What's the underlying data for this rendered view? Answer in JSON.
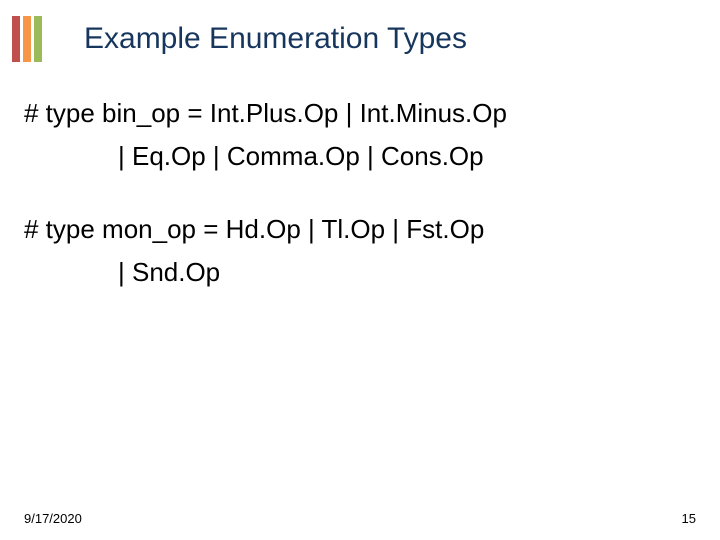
{
  "header": {
    "title": "Example Enumeration Types"
  },
  "body": {
    "p1a": "# type bin_op = Int.Plus.Op |  Int.Minus.Op",
    "p1b": "|  Eq.Op | Comma.Op | Cons.Op",
    "p2a": "# type mon_op = Hd.Op | Tl.Op | Fst.Op",
    "p2b": "| Snd.Op"
  },
  "footer": {
    "date": "9/17/2020",
    "page": "15"
  },
  "accent_colors": {
    "bar1": "#c0504d",
    "bar2": "#f79646",
    "bar3": "#9bbb59"
  }
}
